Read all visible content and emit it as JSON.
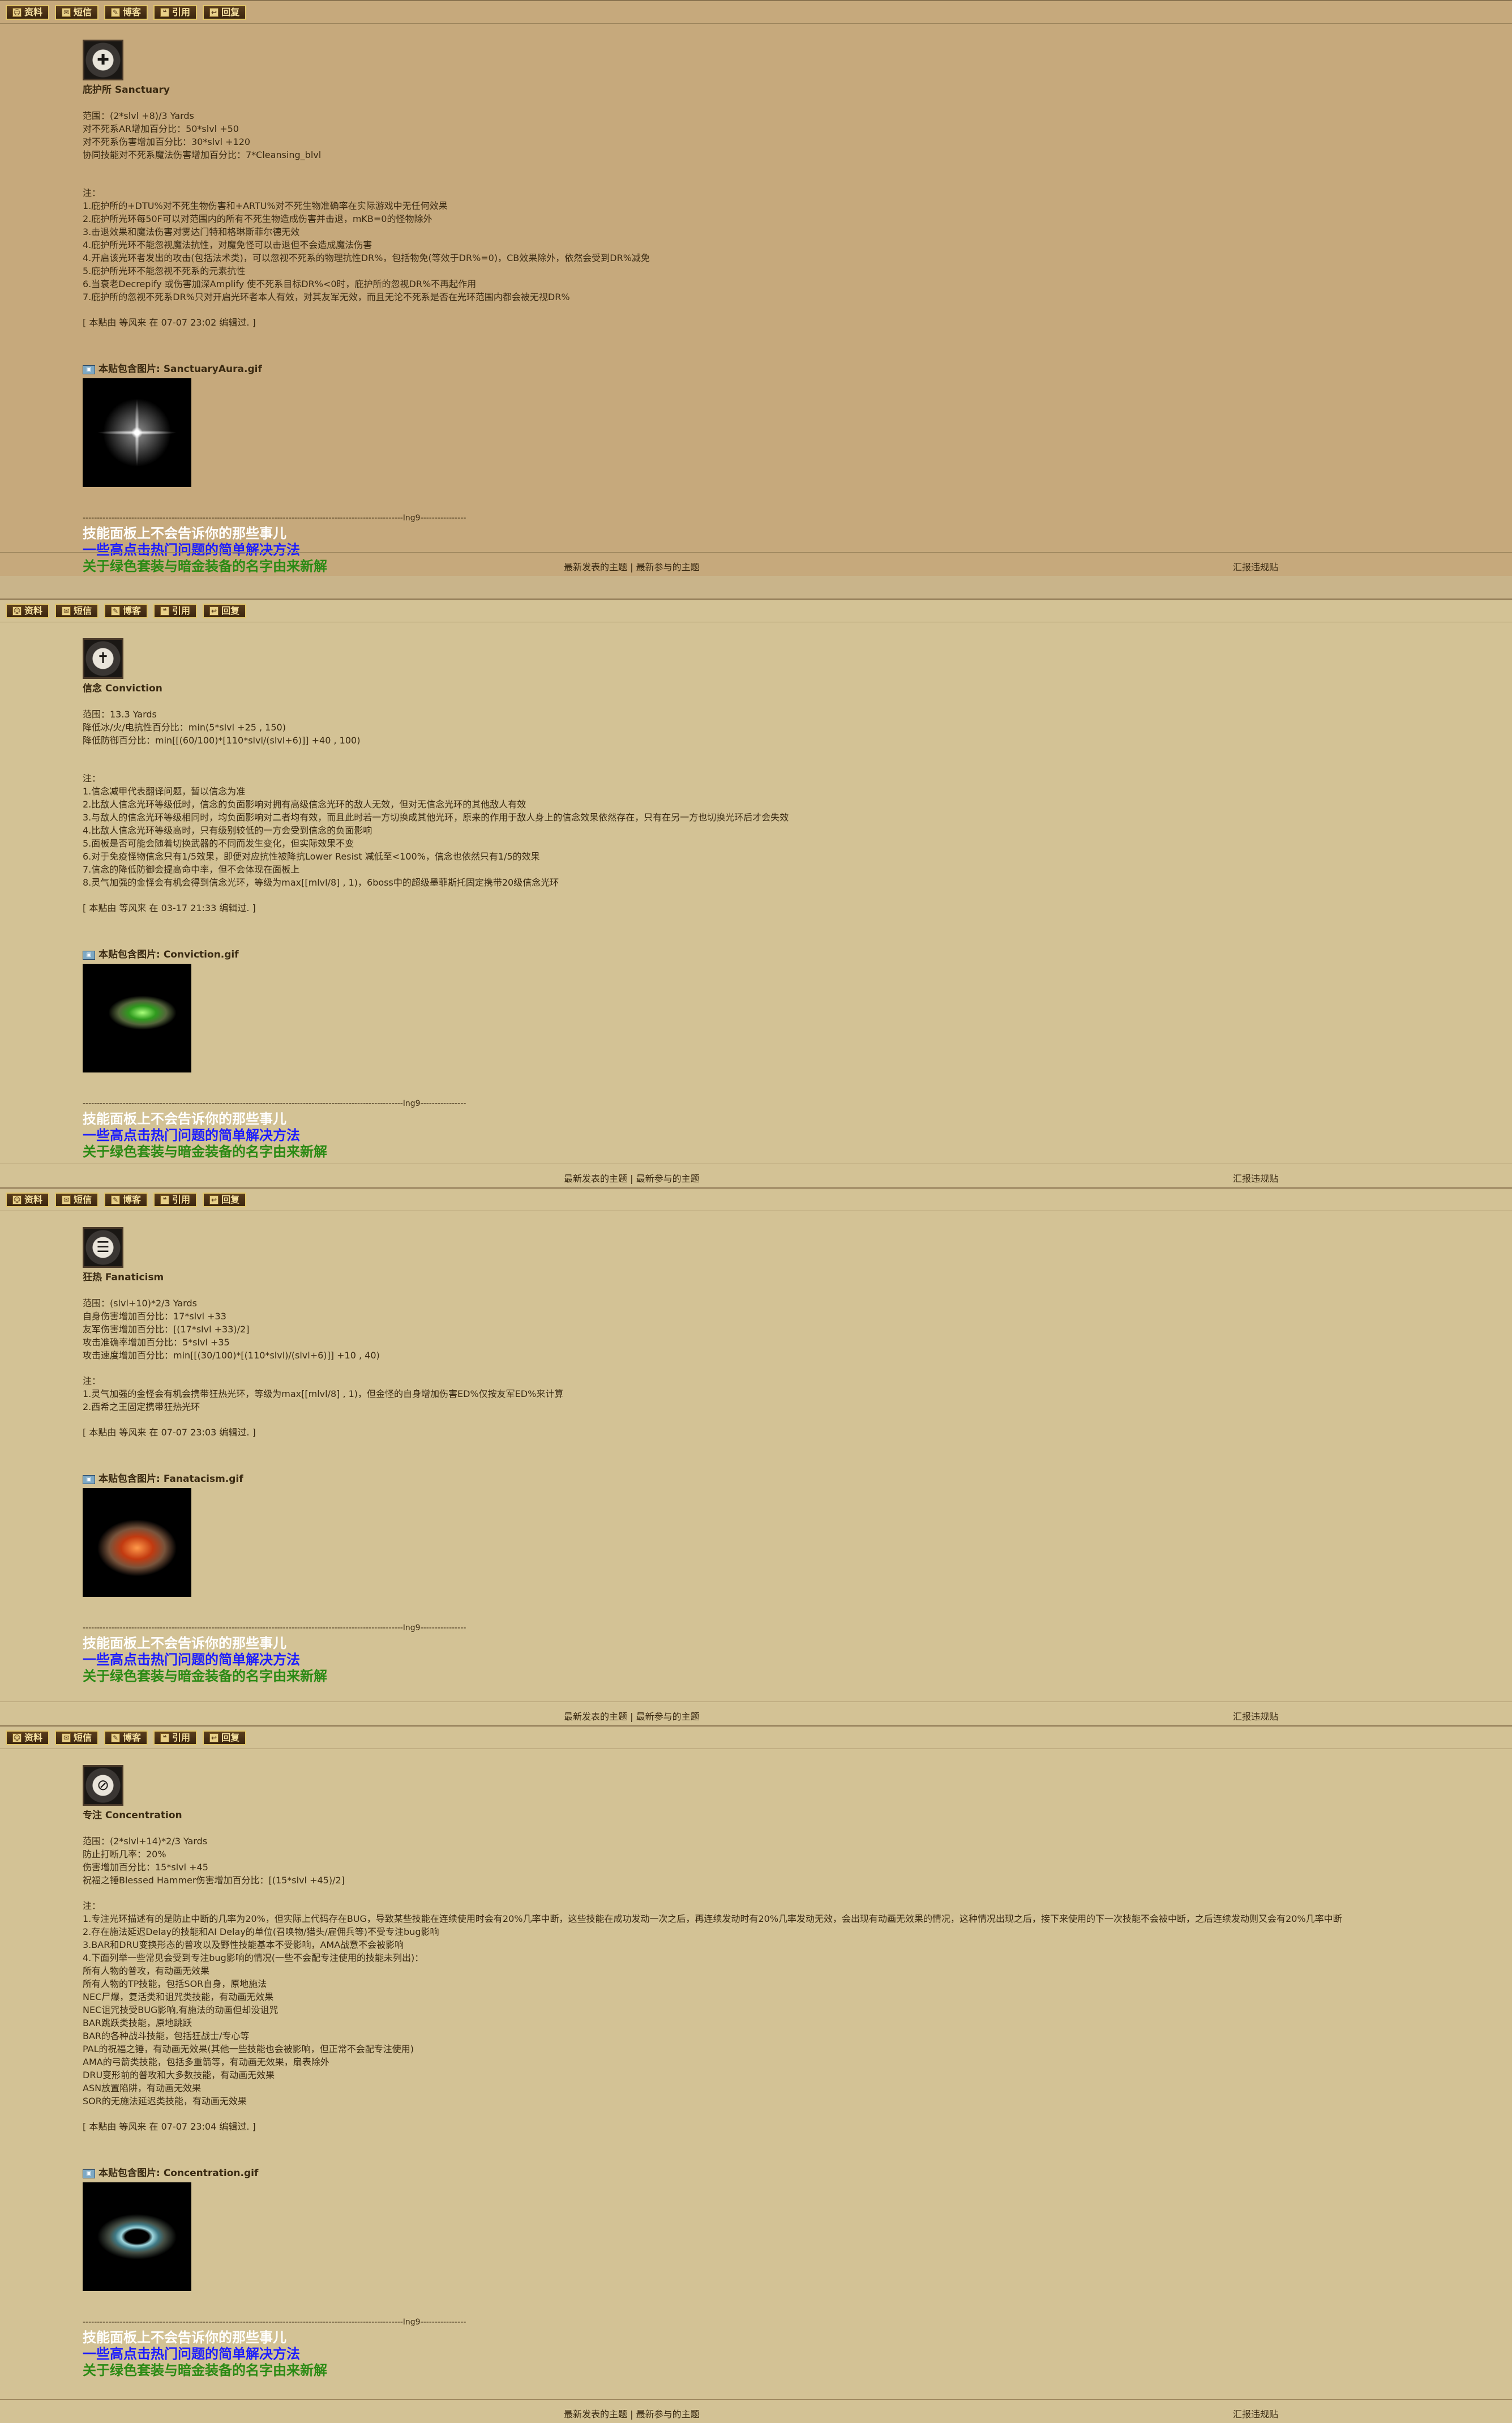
{
  "toolbar": [
    "资料",
    "短信",
    "博客",
    "引用",
    "回复"
  ],
  "footer": {
    "latest_topics": "最新发表的主题",
    "separator": "|",
    "latest_replies": "最新参与的主题",
    "report": "汇报违规贴"
  },
  "signature": {
    "divider": "----------------------------------------------------------------------------------------------------------------Ing9----------------",
    "line1": "技能面板上不会告诉你的那些事儿",
    "line2": "一些高点击热门问题的简单解决方法",
    "line3": "关于绿色套装与暗金装备的名字由来新解"
  },
  "attach_prefix": "本贴包含图片:",
  "posts": [
    {
      "title": "庇护所 Sanctuary",
      "stats": [
        "范围：(2*slvl +8)/3 Yards",
        "对不死系AR增加百分比：50*slvl +50",
        "对不死系伤害增加百分比：30*slvl +120",
        "协同技能对不死系魔法伤害增加百分比：7*Cleansing_blvl"
      ],
      "notes": [
        "注：",
        "1.庇护所的+DTU%对不死生物伤害和+ARTU%对不死生物准确率在实际游戏中无任何效果",
        "2.庇护所光环每50F可以对范围内的所有不死生物造成伤害并击退，mKB=0的怪物除外",
        "3.击退效果和魔法伤害对雾达门特和格琳斯菲尔德无效",
        "4.庇护所光环不能忽视魔法抗性，对魔免怪可以击退但不会造成魔法伤害",
        "4.开启该光环者发出的攻击(包括法术类)，可以忽视不死系的物理抗性DR%，包括物免(等效于DR%=0)，CB效果除外，依然会受到DR%减免",
        "5.庇护所光环不能忽视不死系的元素抗性",
        "6.当衰老Decrepify 或伤害加深Amplify 使不死系目标DR%<0时，庇护所的忽视DR%不再起作用",
        "7.庇护所的忽视不死系DR%只对开启光环者本人有效，对其友军无效，而且无论不死系是否在光环范围内都会被无视DR%"
      ],
      "edited": "[ 本贴由 等风来 在 07-07 23:02 编辑过. ]",
      "attachment": "SanctuaryAura.gif"
    },
    {
      "title": "信念 Conviction",
      "stats": [
        "范围：13.3 Yards",
        "降低冰/火/电抗性百分比：min(5*slvl +25 , 150)",
        "降低防御百分比：min[[(60/100)*[110*slvl/(slvl+6)]] +40 , 100)"
      ],
      "notes": [
        "注：",
        "1.信念减甲代表翻译问题，暂以信念为准",
        "2.比敌人信念光环等级低时，信念的负面影响对拥有高级信念光环的敌人无效，但对无信念光环的其他敌人有效",
        "3.与敌人的信念光环等级相同时，均负面影响对二者均有效，而且此时若一方切换成其他光环，原来的作用于敌人身上的信念效果依然存在，只有在另一方也切换光环后才会失效",
        "4.比敌人信念光环等级高时，只有级别较低的一方会受到信念的负面影响",
        "5.面板是否可能会随着切换武器的不同而发生变化，但实际效果不变",
        "6.对于免疫怪物信念只有1/5效果，即便对应抗性被降抗Lower Resist 减低至<100%，信念也依然只有1/5的效果",
        "7.信念的降低防御会提高命中率，但不会体现在面板上",
        "8.灵气加强的金怪会有机会得到信念光环，等级为max[[mlvl/8] , 1)，6boss中的超级墨菲斯托固定携带20级信念光环"
      ],
      "edited": "[ 本贴由 等风来 在 03-17 21:33 编辑过. ]",
      "attachment": "Conviction.gif"
    },
    {
      "title": "狂热 Fanaticism",
      "stats": [
        "范围：(slvl+10)*2/3 Yards",
        "自身伤害增加百分比：17*slvl +33",
        "友军伤害增加百分比：[(17*slvl +33)/2]",
        "攻击准确率增加百分比：5*slvl +35",
        "攻击速度增加百分比：min[[(30/100)*[(110*slvl)/(slvl+6)]] +10 , 40)"
      ],
      "notes": [
        "注：",
        "1.灵气加强的金怪会有机会携带狂热光环，等级为max[[mlvl/8] , 1)，但金怪的自身增加伤害ED%仅按友军ED%来计算",
        "2.西希之王固定携带狂热光环"
      ],
      "edited": "[ 本贴由 等风来 在 07-07 23:03 编辑过. ]",
      "attachment": "Fanatacism.gif"
    },
    {
      "title": "专注 Concentration",
      "stats": [
        "范围：(2*slvl+14)*2/3 Yards",
        "防止打断几率：20%",
        "伤害增加百分比：15*slvl +45",
        "祝福之锤Blessed Hammer伤害增加百分比：[(15*slvl +45)/2]"
      ],
      "notes": [
        "注：",
        "1.专注光环描述有的是防止中断的几率为20%，但实际上代码存在BUG，导致某些技能在连续使用时会有20%几率中断，这些技能在成功发动一次之后，再连续发动时有20%几率发动无效，会出现有动画无效果的情况，这种情况出现之后，接下来使用的下一次技能不会被中断，之后连续发动则又会有20%几率中断",
        "2.存在施法延迟Delay的技能和AI Delay的单位(召唤物/猎头/雇佣兵等)不受专注bug影响",
        "3.BAR和DRU变换形态的普攻以及野性技能基本不受影响，AMA战意不会被影响",
        "4.下面列举一些常见会受到专注bug影响的情况(一些不会配专注使用的技能未列出)：",
        "  所有人物的普攻，有动画无效果",
        "  所有人物的TP技能，包括SOR自身，原地施法",
        "  NEC尸爆，复活类和诅咒类技能，有动画无效果",
        "  NEC诅咒技受BUG影响,有施法的动画但却没诅咒",
        "  BAR跳跃类技能，原地跳跃",
        "  BAR的各种战斗技能，包括狂战士/专心等",
        "  PAL的祝福之锤，有动画无效果(其他一些技能也会被影响，但正常不会配专注使用)",
        "  AMA的弓箭类技能，包括多重箭等，有动画无效果，扇表除外",
        "  DRU变形前的普攻和大多数技能，有动画无效果",
        "  ASN放置陷阱，有动画无效果",
        "  SOR的无施法延迟类技能，有动画无效果"
      ],
      "edited": "[ 本贴由 等风来 在 07-07 23:04 编辑过. ]",
      "attachment": "Concentration.gif"
    }
  ]
}
